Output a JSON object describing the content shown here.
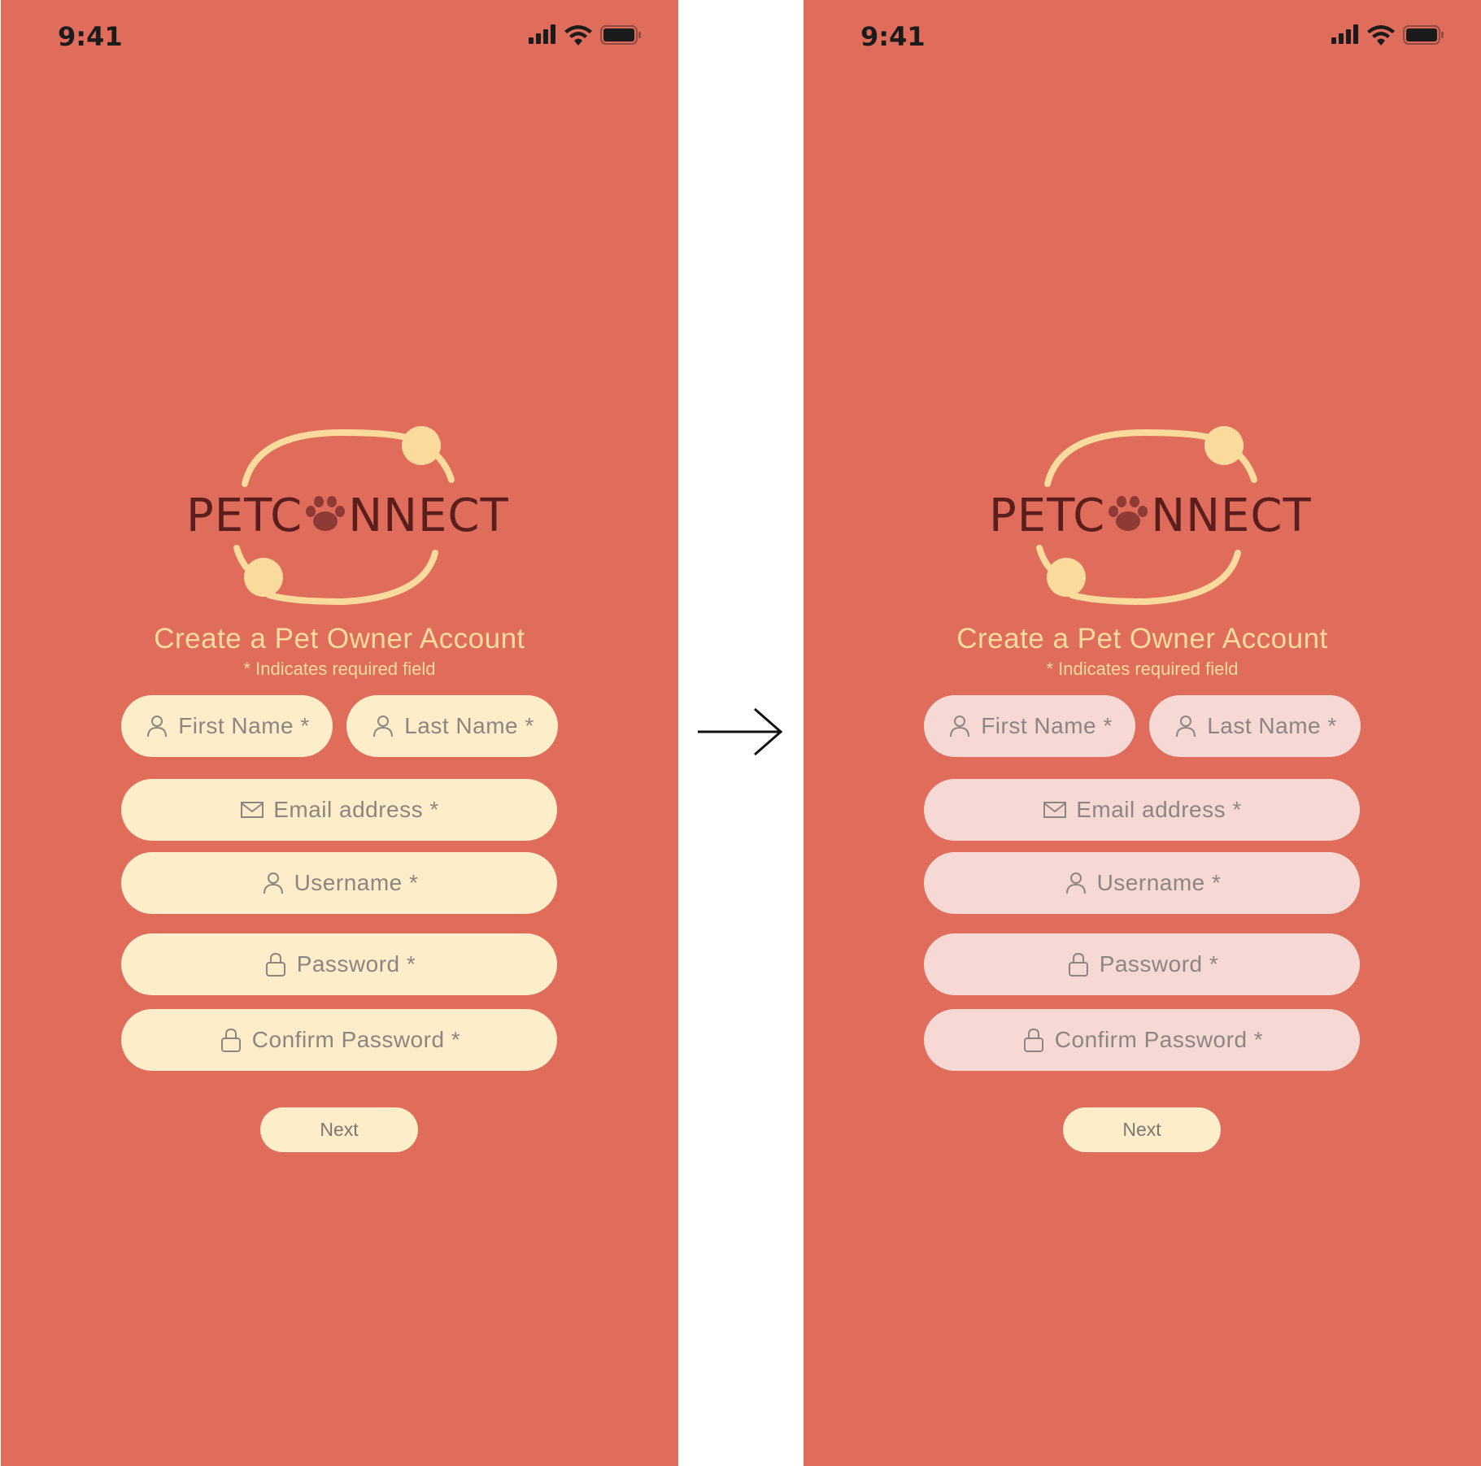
{
  "screens": [
    {
      "status": {
        "time": "9:41"
      },
      "logo": {
        "text_pre": "PETC",
        "text_post": "NNECT"
      },
      "title": "Create a Pet Owner Account",
      "note": "* Indicates required field",
      "fields": {
        "first_name": "First Name *",
        "last_name": "Last Name *",
        "email": "Email address *",
        "username": "Username *",
        "password": "Password *",
        "confirm_password": "Confirm Password *"
      },
      "field_fill_color": "#fdedc9",
      "next_label": "Next"
    },
    {
      "status": {
        "time": "9:41"
      },
      "logo": {
        "text_pre": "PETC",
        "text_post": "NNECT"
      },
      "title": "Create a Pet Owner Account",
      "note": "* Indicates required field",
      "fields": {
        "first_name": "First Name *",
        "last_name": "Last Name *",
        "email": "Email address *",
        "username": "Username *",
        "password": "Password *",
        "confirm_password": "Confirm Password *"
      },
      "field_fill_color": "#f6d9d4",
      "next_label": "Next"
    }
  ],
  "colors": {
    "background": "#e06c5c",
    "accent": "#f9dc9b",
    "logo_text": "#5a1f1c",
    "button_fill": "#fdedc9"
  },
  "icons": [
    "signal-icon",
    "wifi-icon",
    "battery-icon",
    "person-icon",
    "mail-icon",
    "lock-icon",
    "paw-icon",
    "arrow-right-icon"
  ]
}
